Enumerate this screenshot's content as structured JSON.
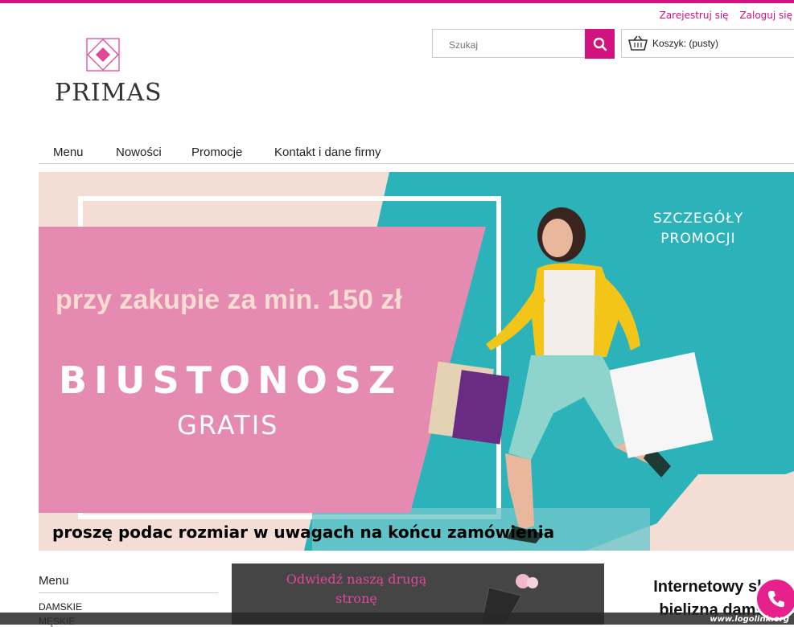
{
  "header": {
    "register_link": "Zarejestruj się",
    "login_link": "Zaloguj się",
    "logo_text": "PRIMAS",
    "search_placeholder": "Szukaj",
    "cart_label": "Koszyk: (pusty)"
  },
  "nav": {
    "items": [
      "Menu",
      "Nowości",
      "Promocje",
      "Kontakt i dane firmy"
    ]
  },
  "banner": {
    "line1": "przy zakupie za min. 150 zł",
    "line2": "BIUSTONOSZ",
    "line3": "GRATIS",
    "details": "SZCZEGÓŁY PROMOCJI",
    "bottom_text": "proszę podac rozmiar w uwagach na końcu zamówienia"
  },
  "sidebar": {
    "title": "Menu",
    "items": [
      "DAMSKIE",
      "MĘSKIE"
    ]
  },
  "promo_box": {
    "text": "Odwiedź naszą drugą stronę"
  },
  "right_block": {
    "title_line1": "Internetowy skl",
    "title_line2": "bielizną dams"
  },
  "watermark": "www.logolink.org",
  "colors": {
    "accent": "#d1127f",
    "banner_pink": "#e58ab1",
    "banner_teal": "#2bb3b9",
    "banner_peach": "#f3ddd4"
  },
  "icons": {
    "search": "magnifier-icon",
    "cart": "basket-icon",
    "phone": "phone-icon",
    "logo": "diamond-logo-icon"
  }
}
